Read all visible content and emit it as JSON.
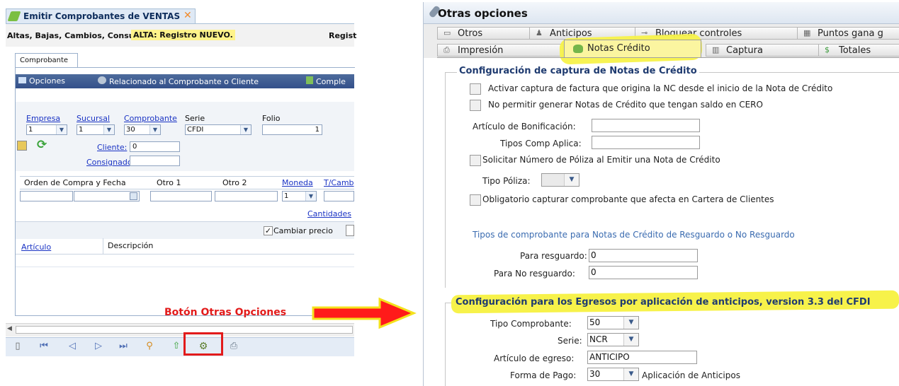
{
  "left": {
    "window_tab_title": "Emitir Comprobantes de VENTAS",
    "info_bar_label": "Altas, Bajas, Cambios, Consult:",
    "info_bar_status": "ALTA: Registro NUEVO.",
    "info_bar_right": "Regist",
    "section_tab": "Comprobante",
    "toolbar": {
      "opciones": "Opciones",
      "relacionado": "Relacionado al Comprobante o Cliente",
      "comple": "Comple"
    },
    "fields": {
      "empresa_label": "Empresa",
      "empresa_value": "1",
      "sucursal_label": "Sucursal",
      "sucursal_value": "1",
      "comprobante_label": "Comprobante",
      "comprobante_value": "30",
      "serie_label": "Serie",
      "serie_value": "CFDI",
      "folio_label": "Folio",
      "folio_value": "1",
      "cliente_label": "Cliente:",
      "cliente_value": "0",
      "consignado_label": "Consignado A:"
    },
    "orden": {
      "orden_label": "Orden de Compra y Fecha",
      "otro1_label": "Otro 1",
      "otro2_label": "Otro 2",
      "moneda_label": "Moneda",
      "moneda_value": "1",
      "tcamb_label": "T/Camb"
    },
    "cantidades_link": "Cantidades",
    "cambiar_precio_label": "Cambiar precio",
    "grid_headers": [
      "Artículo",
      "Descripción"
    ],
    "annotation": "Botón Otras Opciones",
    "colors": {
      "annotation": "#e21b1b",
      "status_highlight": "#fff38a",
      "link": "#1a33c4"
    }
  },
  "right": {
    "window_title": "Otras opciones",
    "tabs_row1": [
      "Otros",
      "Anticipos",
      "Bloquear controles",
      "Puntos gana g"
    ],
    "tabs_row2": [
      "Impresión",
      "Notas Crédito",
      "Captura",
      "Totales"
    ],
    "section1_title": "Configuración de captura de Notas de Crédito",
    "opt_activar": "Activar captura de factura que origina la NC desde el inicio de la Nota de Crédito",
    "opt_no_permitir": "No permitir generar Notas de Crédito que tengan saldo en CERO",
    "articulo_bonif_label": "Artículo de Bonificación:",
    "tipos_comp_label": "Tipos Comp Aplica:",
    "opt_solicitar": "Solicitar Número de Póliza al Emitir una Nota de Crédito",
    "tipo_poliza_label": "Tipo Póliza:",
    "opt_obligatorio": "Obligatorio capturar comprobante que afecta en Cartera de Clientes",
    "tipos_title": "Tipos de comprobante para Notas de Crédito de Resguardo o No Resguardo",
    "para_resguardo_label": "Para resguardo:",
    "para_resguardo_value": "0",
    "para_no_resguardo_label": "Para No resguardo:",
    "para_no_resguardo_value": "0",
    "section2_title": "Configuración para los Egresos por aplicación de anticipos, version 3.3 del CFDI",
    "tipo_comprobante_label": "Tipo Comprobante:",
    "tipo_comprobante_value": "50",
    "serie_label": "Serie:",
    "serie_value": "NCR",
    "articulo_egreso_label": "Artículo de egreso:",
    "articulo_egreso_value": "ANTICIPO",
    "forma_pago_label": "Forma de Pago:",
    "forma_pago_value": "30",
    "forma_pago_desc": "Aplicación de Anticipos",
    "colors": {
      "highlight": "#f7f24a",
      "section_title": "#1f3b70",
      "tipos_title": "#3a6bb0"
    }
  }
}
